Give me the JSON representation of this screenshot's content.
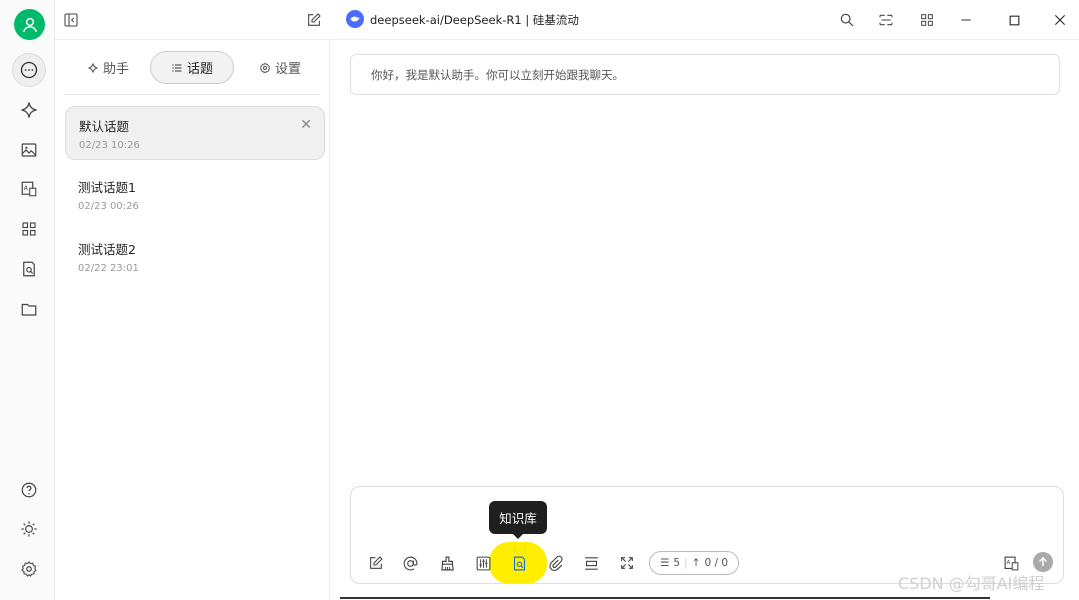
{
  "window": {
    "model_title": "deepseek-ai/DeepSeek-R1 | 硅基流动"
  },
  "tabs": [
    {
      "icon": "sparkle-icon",
      "label": "助手"
    },
    {
      "icon": "list-icon",
      "label": "话题"
    },
    {
      "icon": "gear-icon",
      "label": "设置"
    }
  ],
  "topics": [
    {
      "name": "默认话题",
      "time": "02/23 10:26"
    },
    {
      "name": "测试话题1",
      "time": "02/23 00:26"
    },
    {
      "name": "测试话题2",
      "time": "02/22 23:01"
    }
  ],
  "chat": {
    "greeting": "你好，我是默认助手。你可以立刻开始跟我聊天。"
  },
  "composer": {
    "placeholder": "",
    "token_context": "5",
    "token_usage": "0 / 0",
    "tooltip": "知识库"
  },
  "watermark": "CSDN @勾哥AI编程",
  "colors": {
    "accent": "#00b96b",
    "highlight": "#ffee00",
    "model_badge": "#4d6bfe"
  }
}
